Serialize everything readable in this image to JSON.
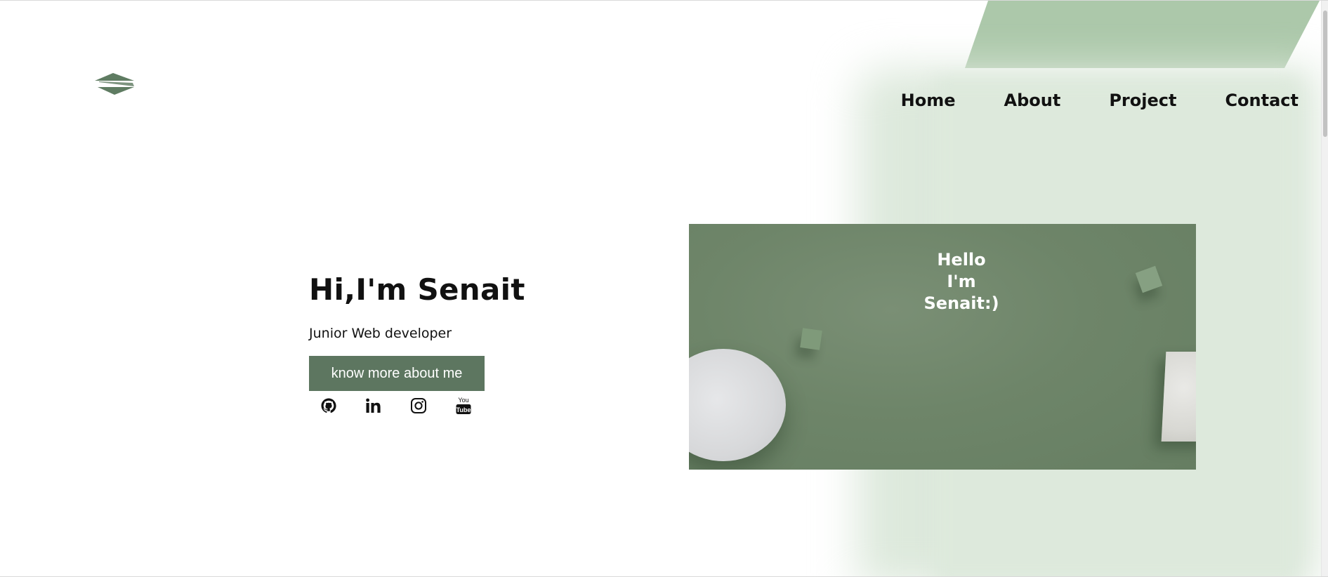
{
  "nav": {
    "items": [
      {
        "label": "Home"
      },
      {
        "label": "About"
      },
      {
        "label": "Project"
      },
      {
        "label": "Contact"
      }
    ]
  },
  "hero": {
    "name": "Hi,I'm Senait",
    "role": "Junior Web developer",
    "cta_label": "know more about me"
  },
  "socials": [
    {
      "icon": "github-icon"
    },
    {
      "icon": "linkedin-icon"
    },
    {
      "icon": "instagram-icon"
    },
    {
      "icon": "youtube-icon",
      "text_top": "You",
      "text_bottom": "Tube"
    }
  ],
  "image": {
    "caption_line1": "Hello",
    "caption_line2": "I'm",
    "caption_line3": "Senait:)"
  },
  "colors": {
    "accent": "#5d7660",
    "parallelogram": "#acc8aa",
    "soft_panel": "#dde9dc"
  }
}
